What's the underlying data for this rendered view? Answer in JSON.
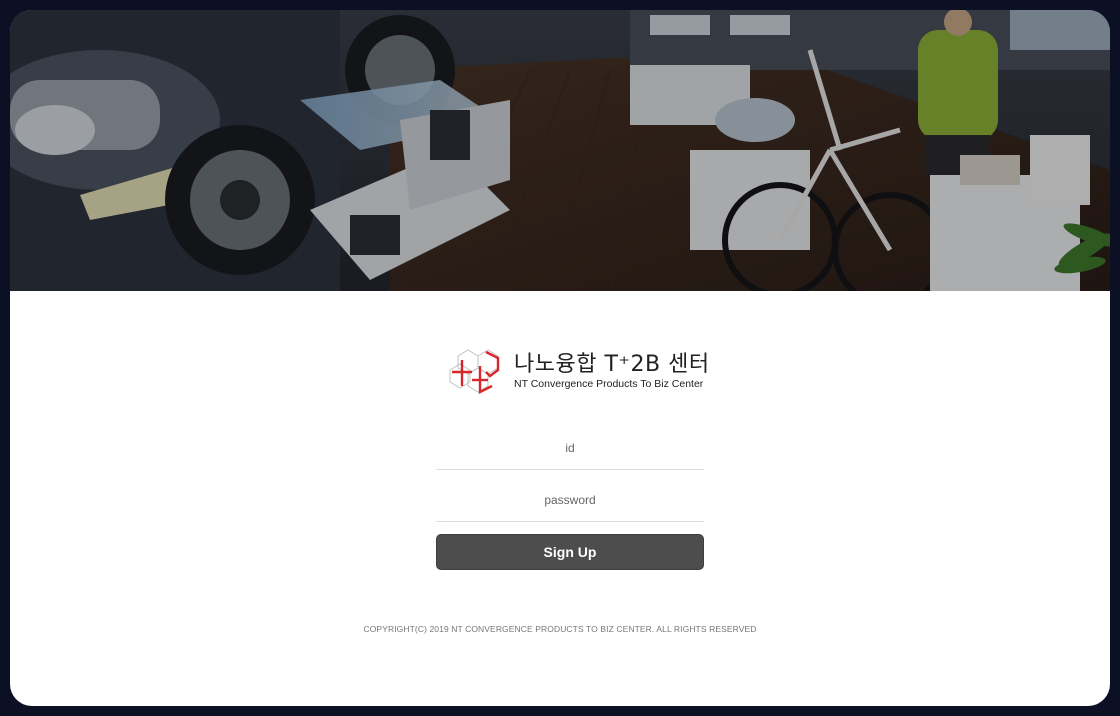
{
  "hero": {
    "image": "exhibition-hall-photo"
  },
  "logo": {
    "mark": "hexagon-cube-logo-icon",
    "korean_name": "나노융합 T⁺2B 센터",
    "english_name": "NT Convergence Products To Biz Center",
    "accent_color": "#d7262c"
  },
  "form": {
    "id_placeholder": "id",
    "password_placeholder": "password",
    "submit_label": "Sign Up",
    "button_color": "#4d4d4d"
  },
  "footer": {
    "copyright": "COPYRIGHT(C) 2019 NT CONVERGENCE PRODUCTS TO BIZ CENTER. ALL RIGHTS RESERVED"
  }
}
